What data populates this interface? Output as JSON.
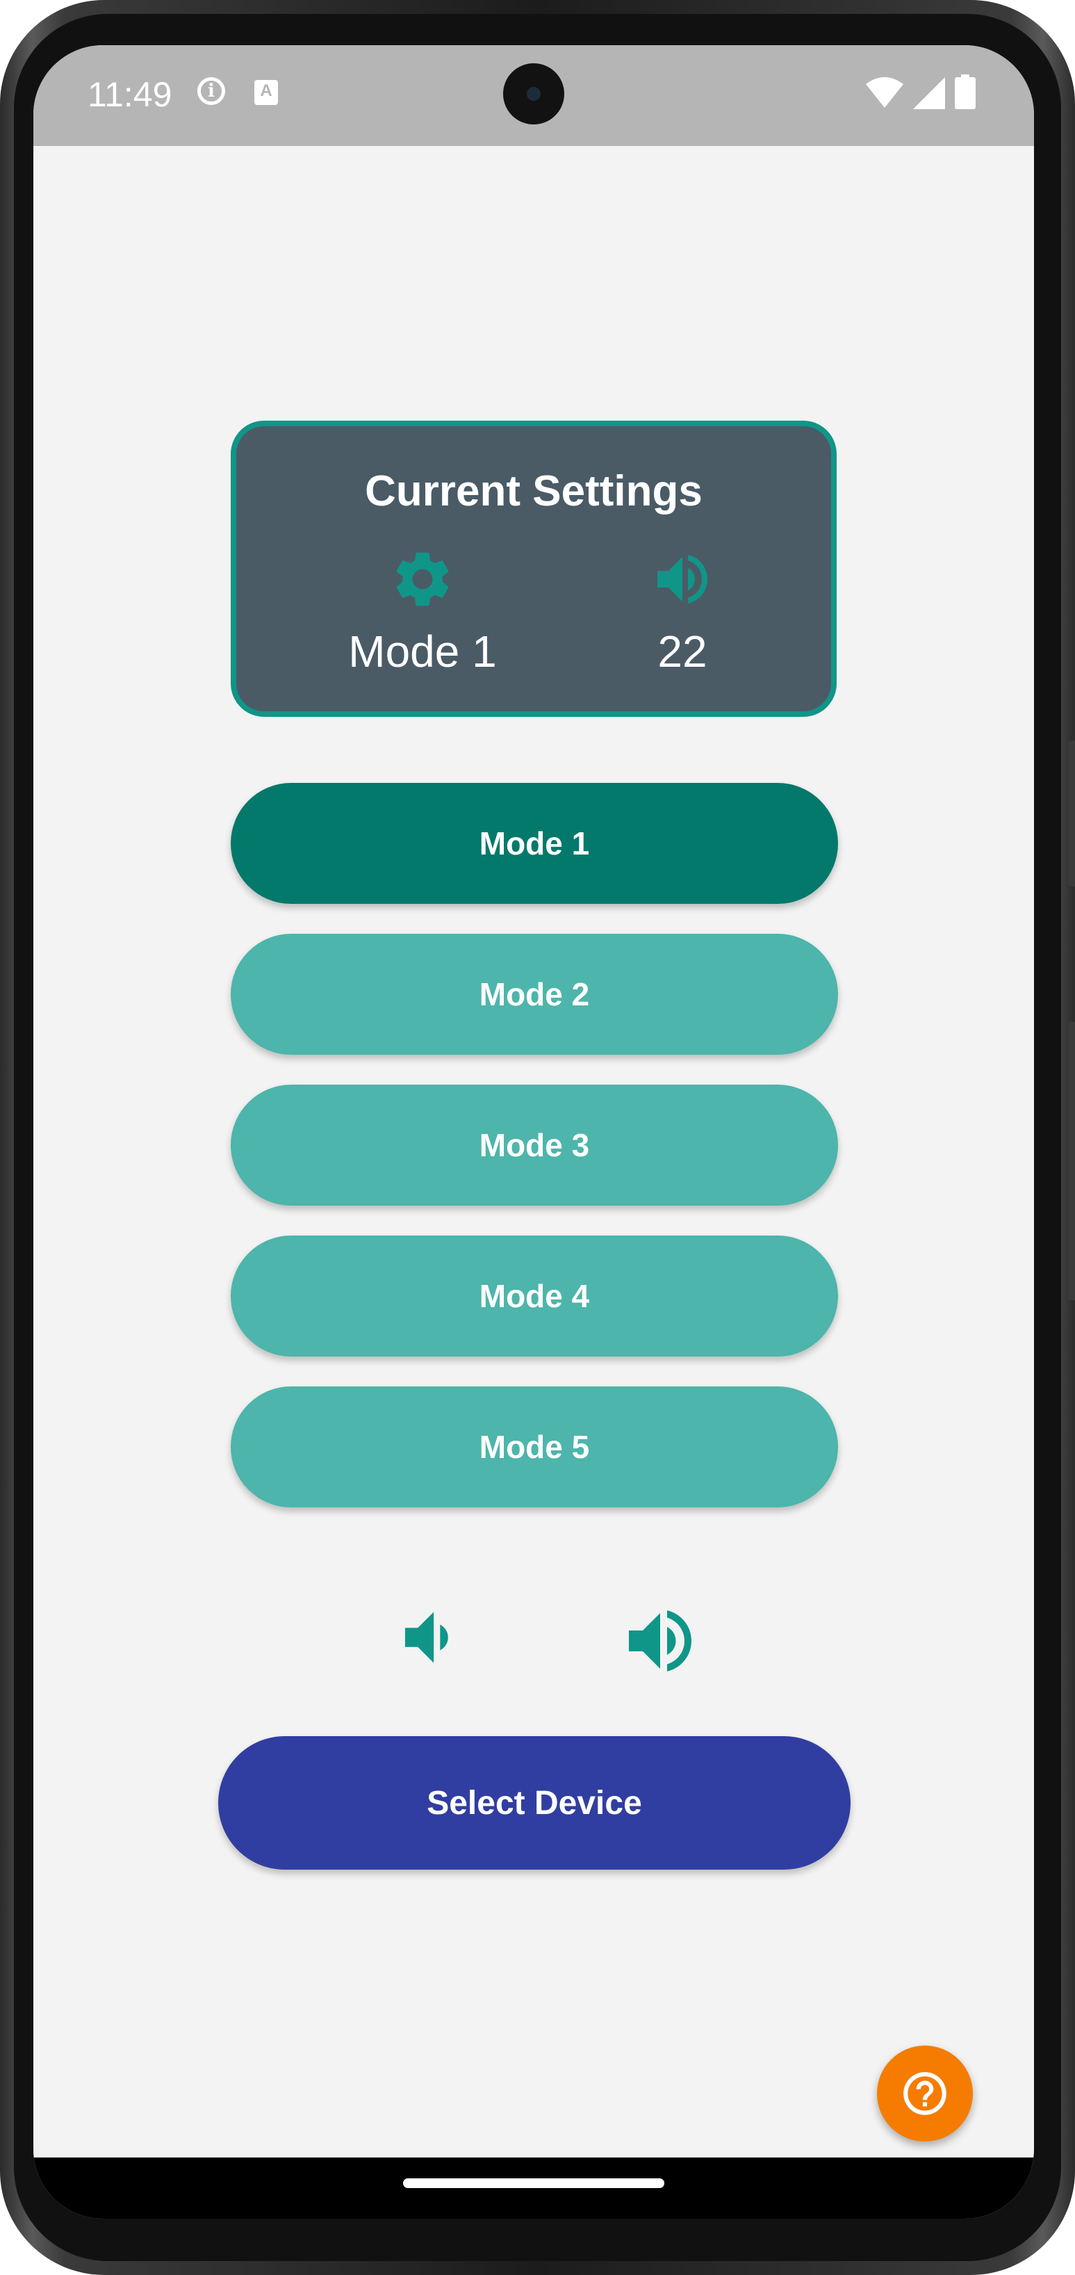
{
  "status_bar": {
    "time": "11:49",
    "info_icon": "info-icon",
    "keyboard_icon": "a-keyboard-icon",
    "wifi_icon": "wifi-icon",
    "signal_icon": "signal-icon",
    "battery_icon": "battery-icon"
  },
  "current_settings": {
    "title": "Current Settings",
    "mode_icon": "gear-icon",
    "mode_value": "Mode 1",
    "volume_icon": "volume-icon",
    "volume_value": "22"
  },
  "modes": [
    {
      "label": "Mode 1",
      "active": true
    },
    {
      "label": "Mode 2",
      "active": false
    },
    {
      "label": "Mode 3",
      "active": false
    },
    {
      "label": "Mode 4",
      "active": false
    },
    {
      "label": "Mode 5",
      "active": false
    }
  ],
  "volume_controls": {
    "down_icon": "volume-down-icon",
    "up_icon": "volume-up-icon"
  },
  "select_device_label": "Select Device",
  "help_icon": "help-icon",
  "colors": {
    "accent": "#0f9688",
    "active_mode": "#03796b",
    "inactive_mode": "#4db5ab",
    "card_bg": "#4a5b66",
    "select_button": "#313ea1",
    "fab": "#f57c00",
    "status_bar": "#b5b5b5"
  }
}
